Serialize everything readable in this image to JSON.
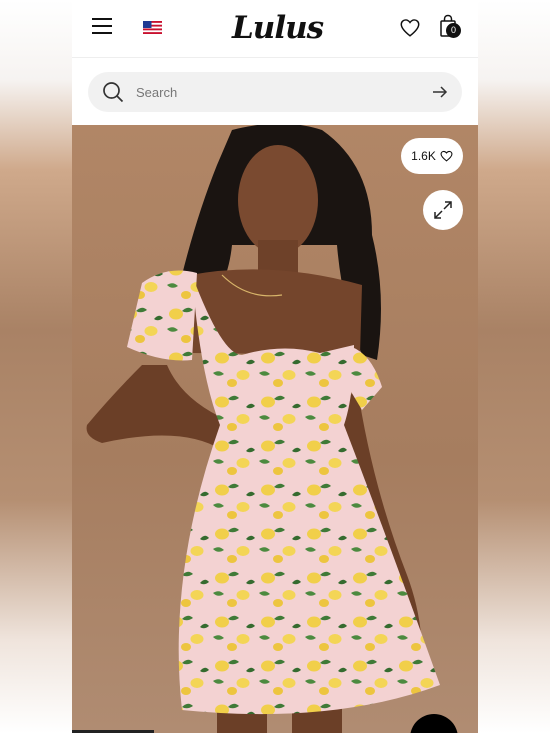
{
  "header": {
    "logo": "Lulus",
    "bag_count": "0"
  },
  "search": {
    "placeholder": "Search"
  },
  "product": {
    "likes": "1.6K"
  },
  "icons": {
    "menu": "hamburger-icon",
    "flag": "us-flag-icon",
    "wishlist": "heart-icon",
    "bag": "shopping-bag-icon",
    "search": "search-icon",
    "submit": "arrow-right-icon",
    "expand": "expand-icon",
    "chat": "chat-icon"
  },
  "colors": {
    "accent": "#111111",
    "search_bg": "#f1f1f1",
    "backdrop": "#a67d5f",
    "dress_base": "#f3cfd0",
    "lemon": "#f1cf4a",
    "leaf": "#3f7a37"
  }
}
